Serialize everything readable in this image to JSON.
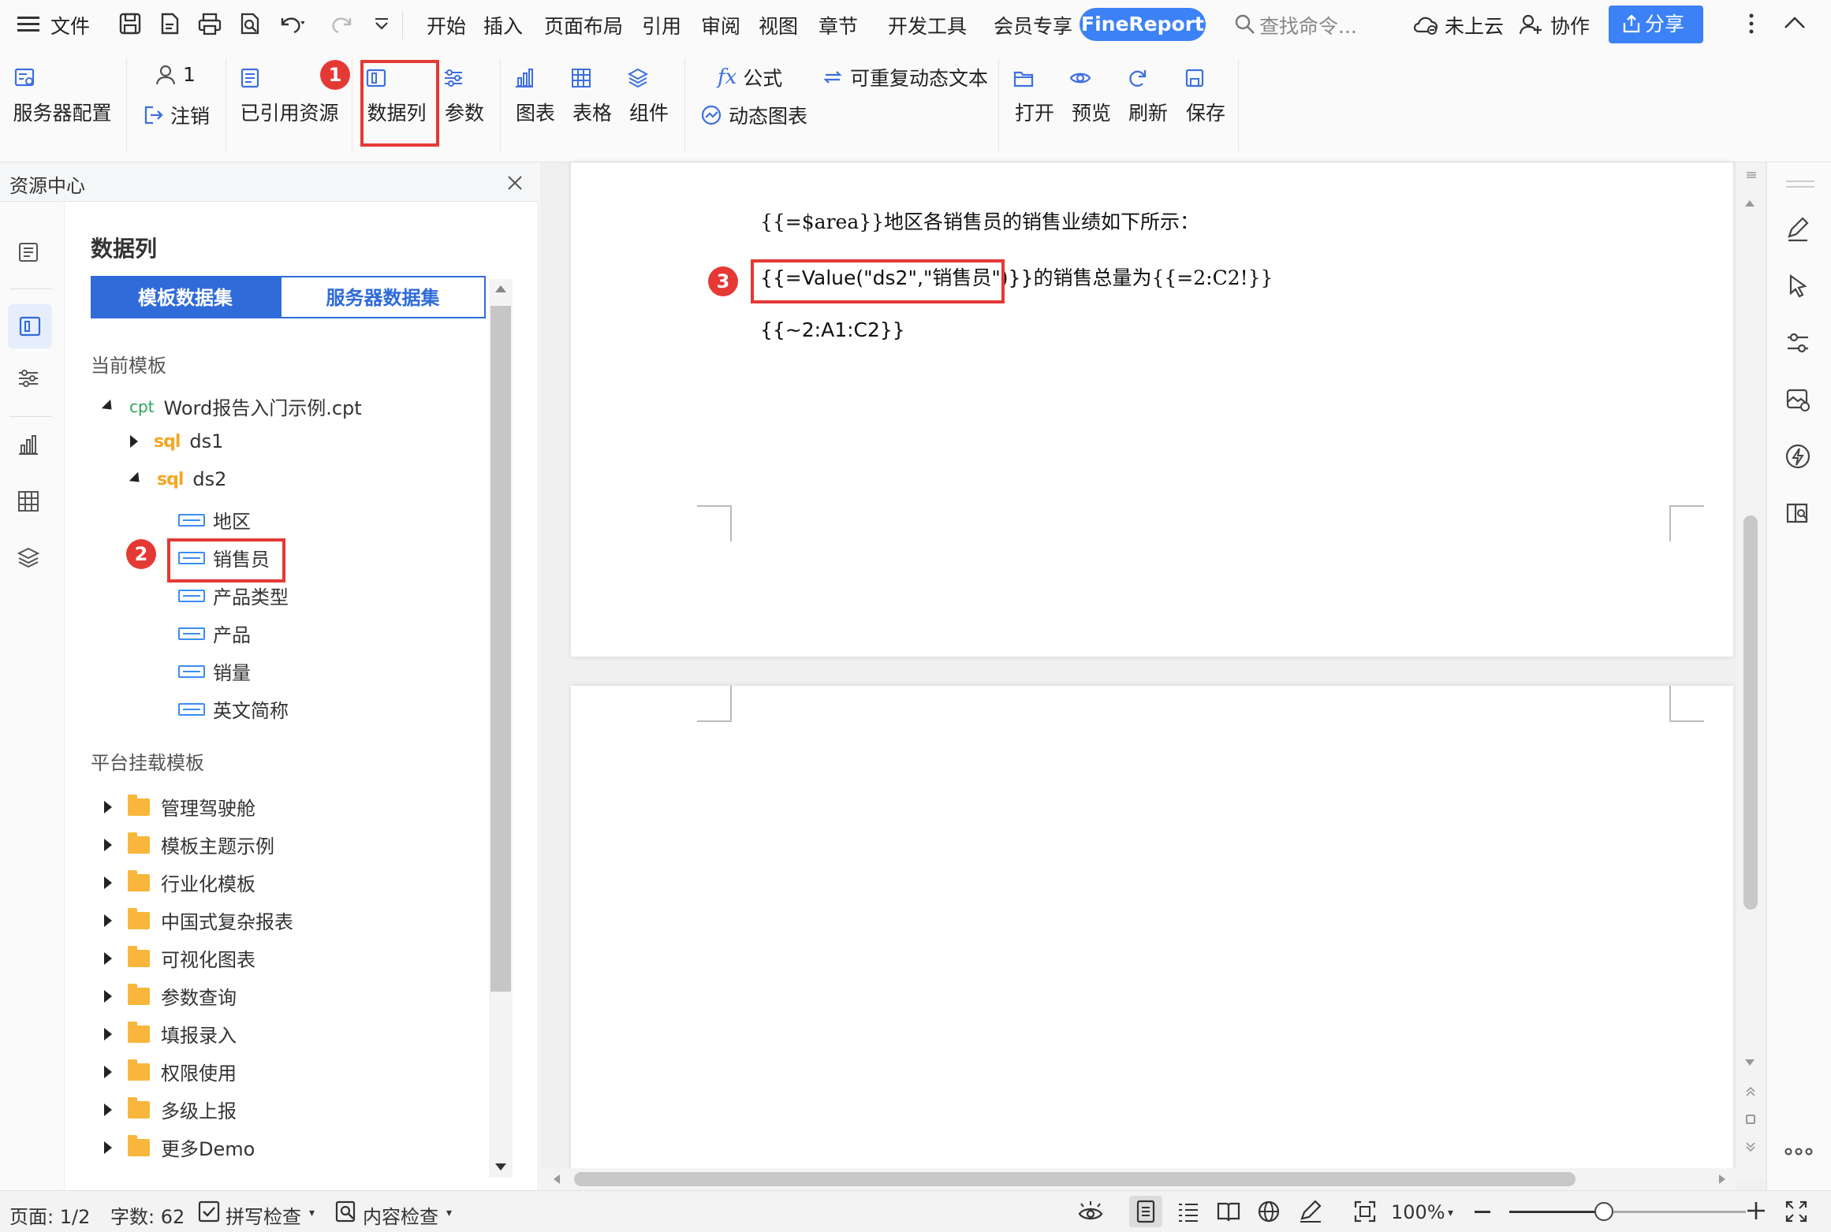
{
  "menubar": {
    "file": "文件",
    "tabs": [
      "开始",
      "插入",
      "页面布局",
      "引用",
      "审阅",
      "视图",
      "章节",
      "开发工具",
      "会员专享"
    ],
    "brand": "FineReport",
    "search_placeholder": "查找命令...",
    "cloud": "未上云",
    "collab": "协作",
    "share": "分享"
  },
  "ribbon": {
    "server_config": "服务器配置",
    "user_count": "1",
    "logout": "注销",
    "referenced": "已引用资源",
    "data_column": "数据列",
    "params": "参数",
    "chart": "图表",
    "table": "表格",
    "component": "组件",
    "formula": "公式",
    "reusable_text": "可重复动态文本",
    "dynamic_chart": "动态图表",
    "open": "打开",
    "preview": "预览",
    "refresh": "刷新",
    "save": "保存"
  },
  "annotations": [
    "1",
    "2",
    "3"
  ],
  "panel": {
    "header": "资源中心",
    "title": "数据列",
    "tab_template": "模板数据集",
    "tab_server": "服务器数据集",
    "current_template_label": "当前模板",
    "template_prefix": "cpt",
    "template_file": "Word报告入门示例.cpt",
    "ds_prefix": "sql",
    "datasets": [
      {
        "name": "ds1",
        "expanded": false
      },
      {
        "name": "ds2",
        "expanded": true,
        "fields": [
          "地区",
          "销售员",
          "产品类型",
          "产品",
          "销量",
          "英文简称"
        ]
      }
    ],
    "platform_label": "平台挂载模板",
    "folders": [
      "管理驾驶舱",
      "模板主题示例",
      "行业化模板",
      "中国式复杂报表",
      "可视化图表",
      "参数查询",
      "填报录入",
      "权限使用",
      "多级上报",
      "更多Demo"
    ]
  },
  "document": {
    "line1": "{{=$area}}地区各销售员的销售业绩如下所示：",
    "line2_code": "{{=Value(\"ds2\",\"销售员\")}}",
    "line2_rest": "的销售总量为{{=2:C2!}}",
    "line3": "{{~2:A1:C2}}"
  },
  "statusbar": {
    "page": "页面: 1/2",
    "words": "字数: 62",
    "spell": "拼写检查",
    "content": "内容检查",
    "zoom": "100%",
    "zoom_level": 0.4
  },
  "colors": {
    "accent": "#3c82f6",
    "annotation": "#e53935",
    "folder": "#f8b63c",
    "field": "#3b8df3",
    "sql": "#f5a623",
    "cpt": "#26a65b"
  }
}
